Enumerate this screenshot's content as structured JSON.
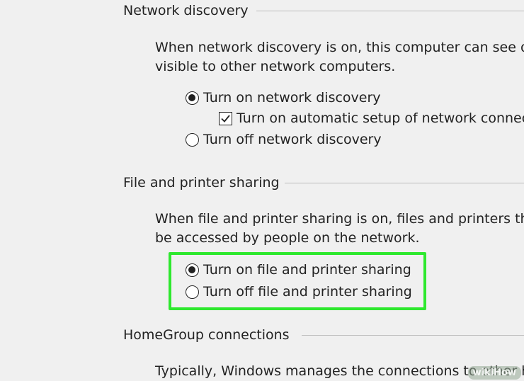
{
  "network_discovery": {
    "heading": "Network discovery",
    "description_line1": "When network discovery is on, this computer can see oth",
    "description_line2": "visible to other network computers.",
    "options": [
      {
        "label": "Turn on network discovery",
        "selected": true
      },
      {
        "label": "Turn off network discovery",
        "selected": false
      }
    ],
    "auto_setup": {
      "label": "Turn on automatic setup of network connec",
      "checked": true
    }
  },
  "file_printer_sharing": {
    "heading": "File and printer sharing",
    "description_line1": "When file and printer sharing is on, files and printers that",
    "description_line2": "be accessed by people on the network.",
    "options": [
      {
        "label": "Turn on file and printer sharing",
        "selected": true
      },
      {
        "label": "Turn off file and printer sharing",
        "selected": false
      }
    ],
    "highlight_color": "#2ee82e"
  },
  "homegroup": {
    "heading": "HomeGroup connections",
    "description_line1": "Typically, Windows manages the connections to other h"
  },
  "watermark": "wikiHow"
}
